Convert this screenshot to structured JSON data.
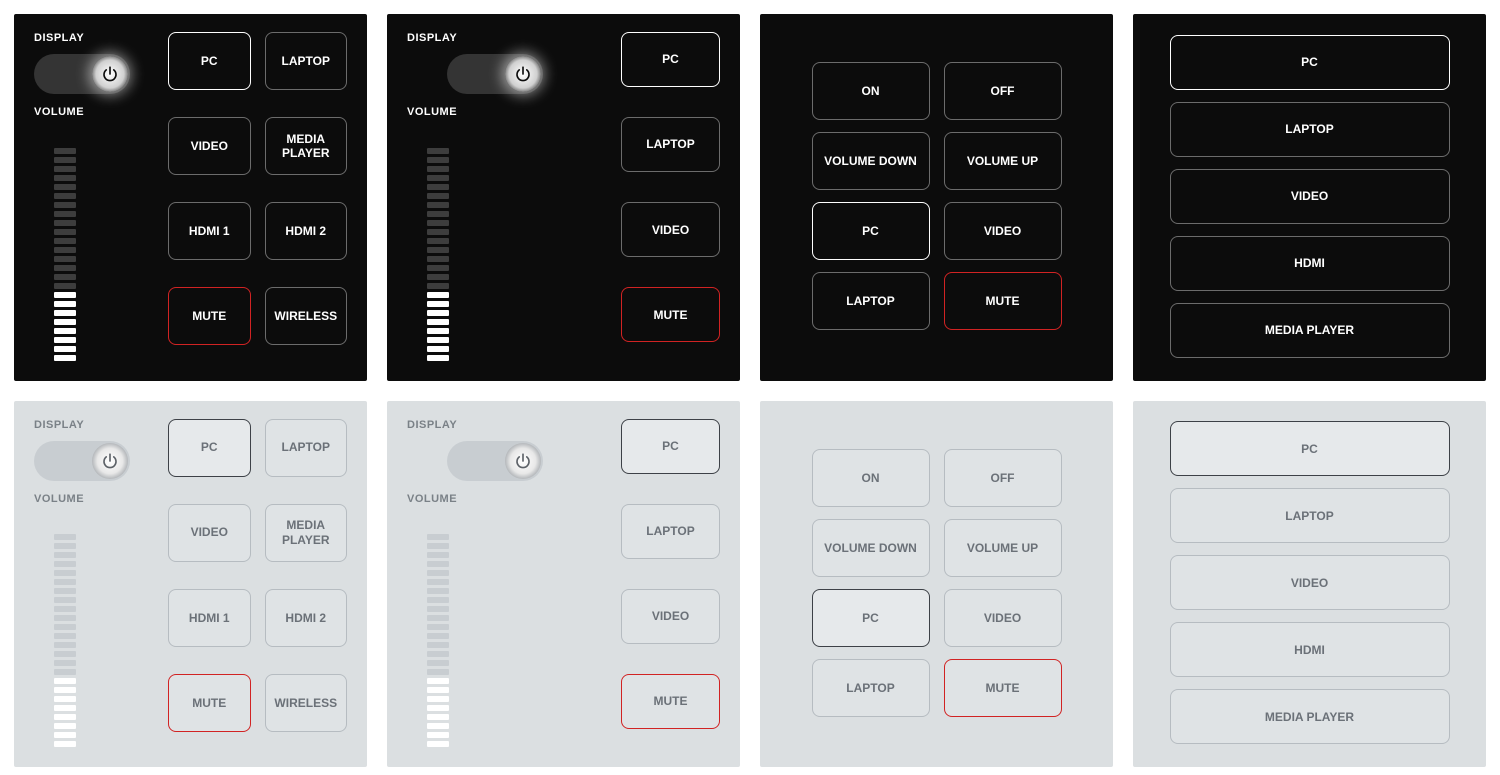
{
  "labels": {
    "display": "DISPLAY",
    "volume": "VOLUME"
  },
  "volume_meter": {
    "total_segments": 24,
    "filled_segments": 8
  },
  "panels": {
    "p1": {
      "theme": "dark",
      "layout": "A",
      "buttons": [
        {
          "label": "PC",
          "selected": true
        },
        {
          "label": "LAPTOP"
        },
        {
          "label": "VIDEO"
        },
        {
          "label": "MEDIA PLAYER"
        },
        {
          "label": "HDMI 1"
        },
        {
          "label": "HDMI 2"
        },
        {
          "label": "MUTE",
          "mute": true
        },
        {
          "label": "WIRELESS"
        }
      ]
    },
    "p2": {
      "theme": "dark",
      "layout": "B",
      "buttons": [
        {
          "label": "PC",
          "selected": true
        },
        {
          "label": "LAPTOP"
        },
        {
          "label": "VIDEO"
        },
        {
          "label": "MUTE",
          "mute": true
        }
      ]
    },
    "p3": {
      "theme": "dark",
      "layout": "C",
      "buttons": [
        {
          "label": "ON"
        },
        {
          "label": "OFF"
        },
        {
          "label": "VOLUME DOWN"
        },
        {
          "label": "VOLUME UP"
        },
        {
          "label": "PC",
          "selected": true
        },
        {
          "label": "VIDEO"
        },
        {
          "label": "LAPTOP"
        },
        {
          "label": "MUTE",
          "mute": true
        }
      ]
    },
    "p4": {
      "theme": "dark",
      "layout": "D",
      "buttons": [
        {
          "label": "PC",
          "selected": true
        },
        {
          "label": "LAPTOP"
        },
        {
          "label": "VIDEO"
        },
        {
          "label": "HDMI"
        },
        {
          "label": "MEDIA PLAYER"
        }
      ]
    },
    "p5": {
      "theme": "light",
      "layout": "A",
      "buttons": [
        {
          "label": "PC",
          "selected": true
        },
        {
          "label": "LAPTOP"
        },
        {
          "label": "VIDEO"
        },
        {
          "label": "MEDIA PLAYER"
        },
        {
          "label": "HDMI 1"
        },
        {
          "label": "HDMI 2"
        },
        {
          "label": "MUTE",
          "mute": true
        },
        {
          "label": "WIRELESS"
        }
      ]
    },
    "p6": {
      "theme": "light",
      "layout": "B",
      "buttons": [
        {
          "label": "PC",
          "selected": true
        },
        {
          "label": "LAPTOP"
        },
        {
          "label": "VIDEO"
        },
        {
          "label": "MUTE",
          "mute": true
        }
      ]
    },
    "p7": {
      "theme": "light",
      "layout": "C",
      "buttons": [
        {
          "label": "ON"
        },
        {
          "label": "OFF"
        },
        {
          "label": "VOLUME DOWN"
        },
        {
          "label": "VOLUME UP"
        },
        {
          "label": "PC",
          "selected": true
        },
        {
          "label": "VIDEO"
        },
        {
          "label": "LAPTOP"
        },
        {
          "label": "MUTE",
          "mute": true
        }
      ]
    },
    "p8": {
      "theme": "light",
      "layout": "D",
      "buttons": [
        {
          "label": "PC",
          "selected": true
        },
        {
          "label": "LAPTOP"
        },
        {
          "label": "VIDEO"
        },
        {
          "label": "HDMI"
        },
        {
          "label": "MEDIA PLAYER"
        }
      ]
    }
  },
  "panel_order": [
    "p1",
    "p2",
    "p3",
    "p4",
    "p5",
    "p6",
    "p7",
    "p8"
  ]
}
